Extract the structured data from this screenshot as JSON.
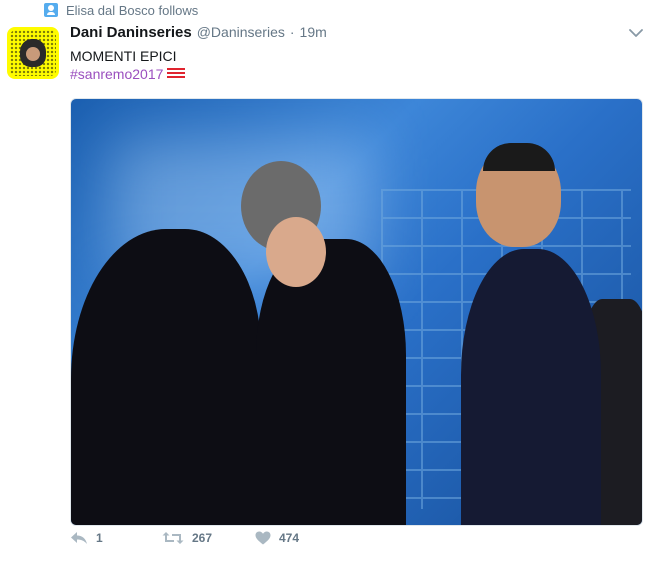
{
  "context": {
    "text": "Elisa dal Bosco follows"
  },
  "tweet": {
    "author_name": "Dani Daninseries",
    "handle": "@Daninseries",
    "separator": "·",
    "time": "19m",
    "text": "MOMENTI EPICI",
    "hashtag": "#sanremo2017"
  },
  "actions": {
    "reply_count": "1",
    "retweet_count": "267",
    "like_count": "474"
  },
  "colors": {
    "hashtag": "#9b4fbf",
    "muted": "#657786",
    "avatar_bg": "#fffc00",
    "icon_blue": "#55acee"
  }
}
